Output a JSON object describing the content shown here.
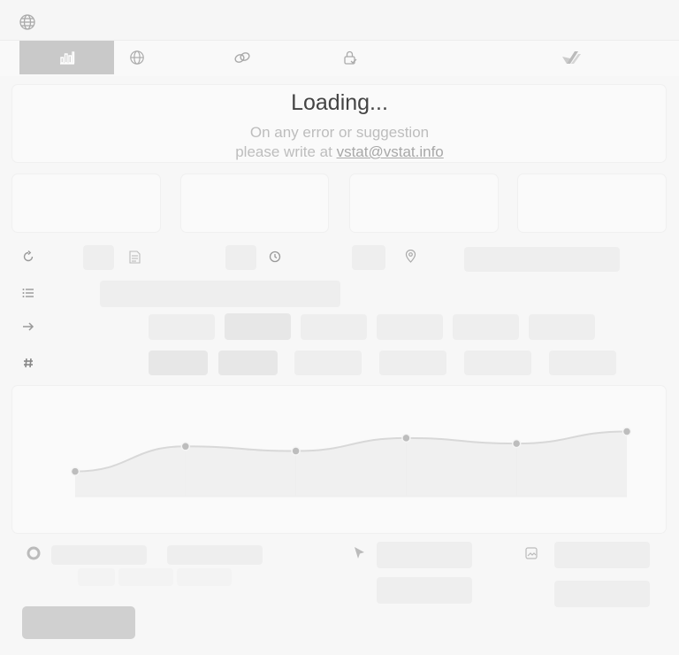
{
  "tabs": [
    {
      "name": "stats",
      "icon": "bar-chart-icon",
      "active": true
    },
    {
      "name": "globe",
      "icon": "globe-icon",
      "active": false
    },
    {
      "name": "link",
      "icon": "link-icon",
      "active": false
    },
    {
      "name": "lock",
      "icon": "lock-check-icon",
      "active": false
    },
    {
      "name": "vstat",
      "icon": "vstat-logo-icon",
      "active": false
    }
  ],
  "loading": {
    "title": "Loading...",
    "line1": "On any error or suggestion",
    "line2_prefix": "please write at ",
    "email": "vstat@vstat.info"
  },
  "side_icons": [
    "refresh-icon",
    "list-icon",
    "arrow-right-icon",
    "hash-icon"
  ],
  "chart_data": {
    "type": "line",
    "points": [
      0,
      1,
      2,
      3,
      4,
      5
    ],
    "values": [
      27,
      54,
      49,
      63,
      57,
      70
    ],
    "ylim": [
      0,
      100
    ],
    "grid": true
  },
  "colors": {
    "active_tab": "#c9c9c9",
    "line": "#d8d8d8",
    "point": "#bdbdbd"
  }
}
